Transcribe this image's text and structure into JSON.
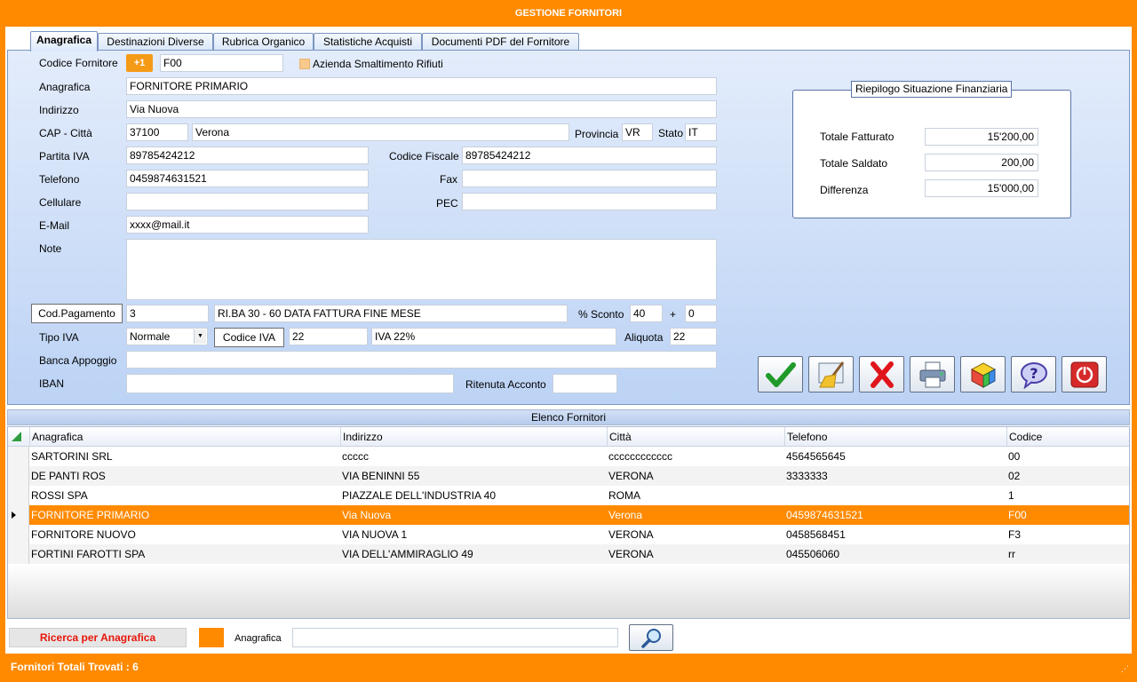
{
  "window": {
    "title": "GESTIONE FORNITORI"
  },
  "tabs": [
    "Anagrafica",
    "Destinazioni Diverse",
    "Rubrica Organico",
    "Statistiche Acquisti",
    "Documenti PDF del Fornitore"
  ],
  "form": {
    "codice_fornitore_label": "Codice Fornitore",
    "plus_badge": "+1",
    "codice_fornitore_value": "F00",
    "azienda_rifiuti_label": "Azienda Smaltimento Rifiuti",
    "anagrafica_label": "Anagrafica",
    "anagrafica_value": "FORNITORE PRIMARIO",
    "indirizzo_label": "Indirizzo",
    "indirizzo_value": "Via Nuova",
    "cap_citta_label": "CAP - Città",
    "cap_value": "37100",
    "citta_value": "Verona",
    "provincia_label": "Provincia",
    "provincia_value": "VR",
    "stato_label": "Stato",
    "stato_value": "IT",
    "partita_iva_label": "Partita IVA",
    "partita_iva_value": "89785424212",
    "codice_fiscale_label": "Codice Fiscale",
    "codice_fiscale_value": "89785424212",
    "telefono_label": "Telefono",
    "telefono_value": "0459874631521",
    "fax_label": "Fax",
    "fax_value": "",
    "cellulare_label": "Cellulare",
    "cellulare_value": "",
    "pec_label": "PEC",
    "pec_value": "",
    "email_label": "E-Mail",
    "email_value": "xxxx@mail.it",
    "note_label": "Note",
    "note_value": "",
    "cod_pagamento_label": "Cod.Pagamento",
    "cod_pagamento_value": "3",
    "pagamento_desc": "RI.BA 30 - 60 DATA FATTURA FINE MESE",
    "sconto_label": "% Sconto",
    "sconto_value": "40",
    "plus_sign": "+",
    "sconto2_value": "0",
    "tipo_iva_label": "Tipo IVA",
    "tipo_iva_value": "Normale",
    "codice_iva_label": "Codice IVA",
    "codice_iva_value": "22",
    "iva_desc": "IVA 22%",
    "aliquota_label": "Aliquota",
    "aliquota_value": "22",
    "banca_label": "Banca Appoggio",
    "banca_value": "",
    "iban_label": "IBAN",
    "iban_value": "",
    "ritenuta_label": "Ritenuta Acconto",
    "ritenuta_value": ""
  },
  "finanziaria": {
    "title": "Riepilogo Situazione Finanziaria",
    "fatturato_label": "Totale Fatturato",
    "fatturato_value": "15'200,00",
    "saldato_label": "Totale Saldato",
    "saldato_value": "200,00",
    "differenza_label": "Differenza",
    "differenza_value": "15'000,00"
  },
  "buttons": [
    "confirm-icon",
    "broom-icon",
    "delete-icon",
    "print-icon",
    "cube-icon",
    "help-icon",
    "power-icon"
  ],
  "grid": {
    "title": "Elenco Fornitori",
    "columns": [
      "Anagrafica",
      "Indirizzo",
      "Città",
      "Telefono",
      "Codice"
    ],
    "rows": [
      [
        "SARTORINI SRL",
        "ccccc",
        "cccccccccccc",
        "4564565645",
        "00"
      ],
      [
        "DE PANTI ROS",
        "VIA BENINNI 55",
        "VERONA",
        "3333333",
        "02"
      ],
      [
        "ROSSI SPA",
        "PIAZZALE DELL'INDUSTRIA 40",
        "ROMA",
        "",
        "1"
      ],
      [
        "FORNITORE PRIMARIO",
        "Via Nuova",
        "Verona",
        "0459874631521",
        "F00"
      ],
      [
        "FORNITORE NUOVO",
        "VIA NUOVA 1",
        "VERONA",
        "0458568451",
        "F3"
      ],
      [
        "FORTINI FAROTTI SPA",
        "VIA DELL'AMMIRAGLIO 49",
        "VERONA",
        "045506060",
        "rr"
      ]
    ],
    "selected_row": 3
  },
  "search": {
    "mode_label": "Ricerca per Anagrafica",
    "field_label": "Anagrafica",
    "value": ""
  },
  "status": {
    "text": "Fornitori Totali Trovati : 6"
  },
  "colors": {
    "accent": "#ff8a00",
    "panel": "#bcd3f5",
    "search_label": "#e8160c"
  }
}
